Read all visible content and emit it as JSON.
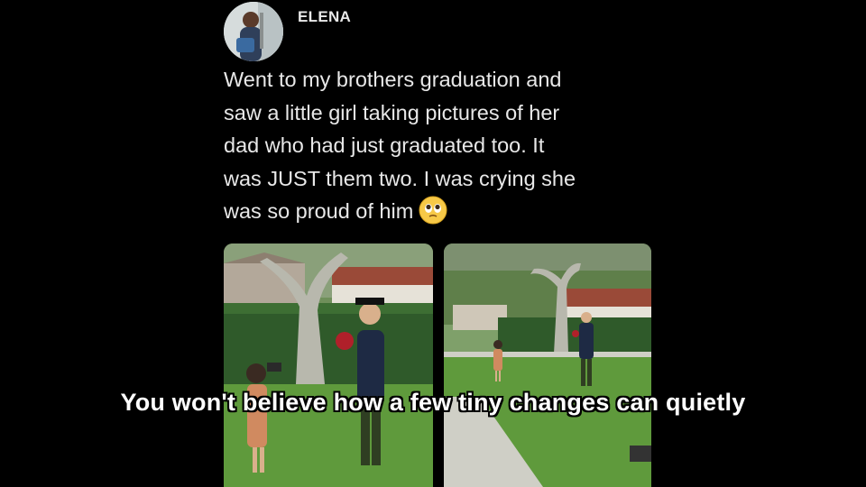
{
  "tweet": {
    "author": "ELENA",
    "text_lines": [
      "Went to my brothers graduation and",
      "saw a little girl taking pictures of her",
      "dad who had just graduated too. It",
      "was JUST them two. I was crying she",
      "was so proud of him"
    ],
    "emoji": "pleading-face-icon"
  },
  "media": {
    "photos": [
      "graduation-photo-left",
      "graduation-photo-right"
    ]
  },
  "subtitle": {
    "text": "You won't believe how a few tiny changes can quietly"
  }
}
